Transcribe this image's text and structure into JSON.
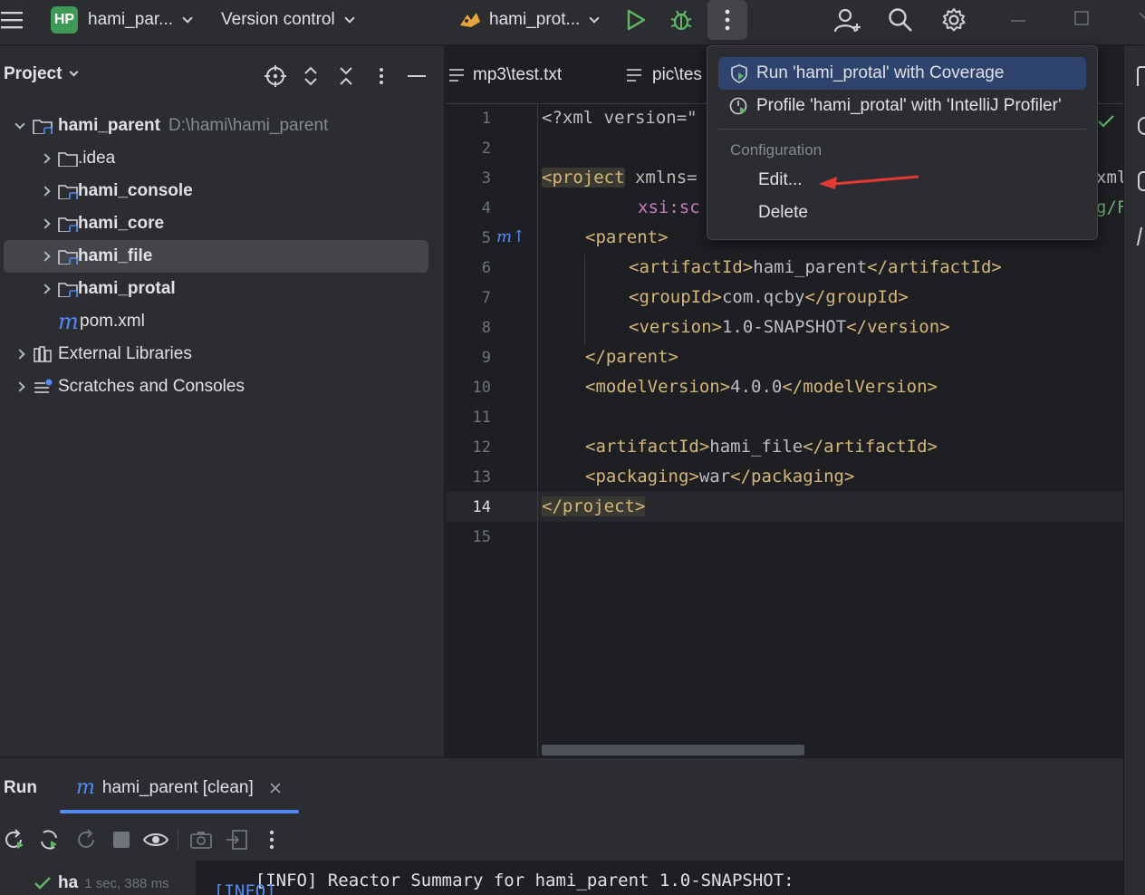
{
  "titlebar": {
    "project_badge": "HP",
    "project_name": "hami_par...",
    "vcs_label": "Version control",
    "run_config": "hami_prot..."
  },
  "project_panel": {
    "title": "Project",
    "root": {
      "name": "hami_parent",
      "path": "D:\\hami\\hami_parent"
    },
    "items": [
      {
        "label": ".idea"
      },
      {
        "label": "hami_console"
      },
      {
        "label": "hami_core"
      },
      {
        "label": "hami_file"
      },
      {
        "label": "hami_protal"
      },
      {
        "label": "pom.xml"
      }
    ],
    "external_libraries": "External Libraries",
    "scratches": "Scratches and Consoles"
  },
  "editor": {
    "tabs": [
      {
        "label": "mp3\\test.txt"
      },
      {
        "label": "pic\\tes"
      }
    ],
    "line_numbers": [
      "1",
      "2",
      "3",
      "4",
      "5",
      "6",
      "7",
      "8",
      "9",
      "10",
      "11",
      "12",
      "13",
      "14",
      "15"
    ],
    "code": {
      "l1": "<?xml version=\"",
      "l3_tag": "<project",
      "l3_rest": " xmlns=",
      "l3_right": "xml",
      "l4": "xsi:sc",
      "l4_right": "g/F",
      "l5": "<parent>",
      "l6_open": "<artifactId>",
      "l6_val": "hami_parent",
      "l6_close": "</artifactId>",
      "l7_open": "<groupId>",
      "l7_val": "com.qcby",
      "l7_close": "</groupId>",
      "l8_open": "<version>",
      "l8_val": "1.0-SNAPSHOT",
      "l8_close": "</version>",
      "l9": "</parent>",
      "l10_open": "<modelVersion>",
      "l10_val": "4.0.0",
      "l10_close": "</modelVersion>",
      "l12_open": "<artifactId>",
      "l12_val": "hami_file",
      "l12_close": "</artifactId>",
      "l13_open": "<packaging>",
      "l13_val": "war",
      "l13_close": "</packaging>",
      "l14": "</project>"
    },
    "maven_gutter_icon": "m↑"
  },
  "popup": {
    "item_coverage": "Run 'hami_protal' with Coverage",
    "item_profile": "Profile 'hami_protal' with 'IntelliJ Profiler'",
    "section_header": "Configuration",
    "item_edit": "Edit...",
    "item_delete": "Delete"
  },
  "run_panel": {
    "title": "Run",
    "tab_label": "hami_parent [clean]",
    "tree_item": "ha",
    "tree_time": "1 sec, 388 ms",
    "console_line1": "[INFO] Reactor Summary for hami_parent 1.0-SNAPSHOT:",
    "console_line2": "[INFO]"
  },
  "colors": {
    "accent": "#548af7",
    "popup_selected": "#2e436e",
    "run_green": "#5fb865",
    "annotation_arrow": "#e53935"
  }
}
